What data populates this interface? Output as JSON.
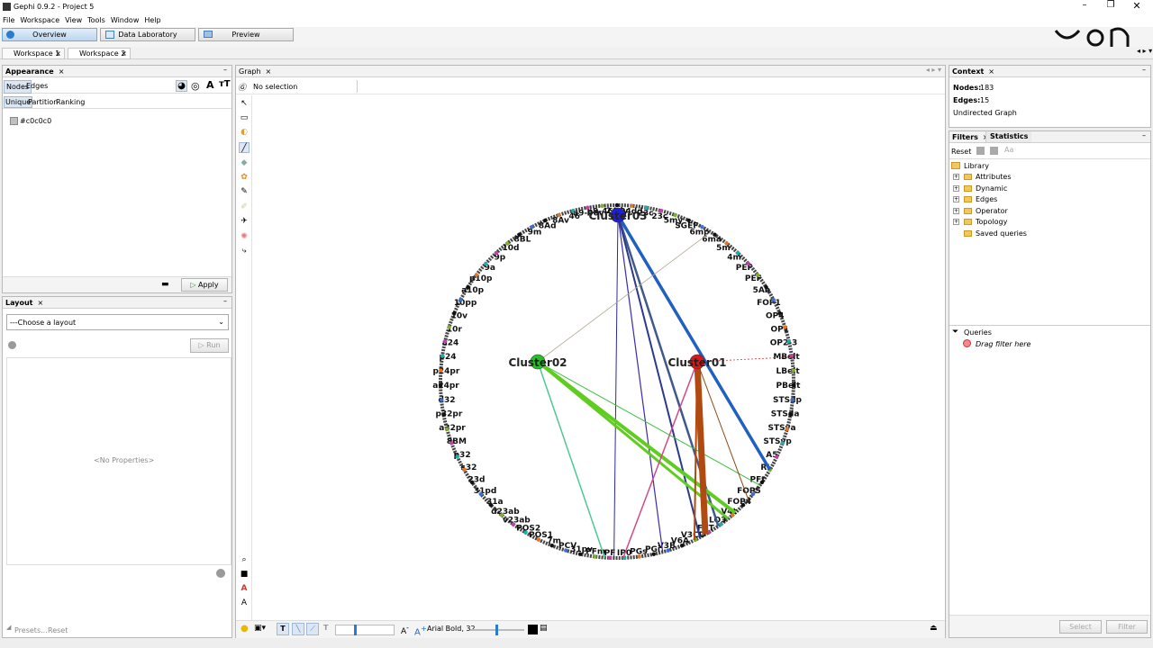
{
  "window": {
    "title": "Gephi 0.9.2 - Project 5"
  },
  "menu": [
    "File",
    "Workspace",
    "View",
    "Tools",
    "Window",
    "Help"
  ],
  "modes": {
    "overview": "Overview",
    "data_lab": "Data Laboratory",
    "preview": "Preview"
  },
  "workspaces": [
    "Workspace 1",
    "Workspace 2"
  ],
  "appearance": {
    "title": "Appearance",
    "tabs": [
      "Nodes",
      "Edges"
    ],
    "subtabs": [
      "Unique",
      "Partition",
      "Ranking"
    ],
    "color_value": "#c0c0c0",
    "apply": "Apply"
  },
  "layout": {
    "title": "Layout",
    "choose": "---Choose a layout",
    "run": "Run",
    "no_props": "<No Properties>",
    "presets": "Presets...",
    "reset": "Reset"
  },
  "graph": {
    "tab": "Graph",
    "selection": "No selection",
    "font_label": "Arial Bold, 32",
    "clusters": [
      {
        "label": "Cluster03",
        "color": "#1f1fd6"
      },
      {
        "label": "Cluster02",
        "color": "#22c422"
      },
      {
        "label": "Cluster01",
        "color": "#e41414"
      }
    ],
    "ring_labels": [
      "24dy",
      "24dd",
      "23c",
      "23c",
      "5my",
      "SGEF",
      "6mp",
      "6ma",
      "5m",
      "4m",
      "PEF",
      "PEF",
      "5Ab",
      "FOP1",
      "OP4",
      "OP1",
      "OP2-3",
      "MBelt",
      "LBelt",
      "PBelt",
      "STSdp",
      "STSda",
      "STSva",
      "STSvp",
      "A5",
      "RI",
      "PFt",
      "FOP5",
      "FOP4",
      "V4t",
      "LO3",
      "FST",
      "V3CD",
      "V6A",
      "V3B",
      "PGi",
      "PGs",
      "IP0",
      "PF",
      "PFm",
      "31pv",
      "PCV",
      "7m",
      "POS1",
      "POS2",
      "v23ab",
      "d23ab",
      "31a",
      "31pd",
      "23d",
      "s32",
      "p32",
      "8BM",
      "a32pr",
      "p32pr",
      "d32",
      "a24pr",
      "p24pr",
      "p24",
      "a24",
      "10r",
      "10v",
      "10pp",
      "a10p",
      "p10p",
      "9a",
      "9p",
      "10d",
      "8BL",
      "9m",
      "8Ad",
      "8Av",
      "46",
      "a9-46v",
      "p9-46v"
    ]
  },
  "context": {
    "title": "Context",
    "nodes_label": "Nodes:",
    "nodes": "183",
    "edges_label": "Edges:",
    "edges": "15",
    "type": "Undirected Graph"
  },
  "filters": {
    "title": "Filters",
    "stats_title": "Statistics",
    "reset": "Reset",
    "library": "Library",
    "items": [
      "Attributes",
      "Dynamic",
      "Edges",
      "Operator",
      "Topology",
      "Saved queries"
    ],
    "queries": "Queries",
    "drag": "Drag filter here",
    "select": "Select",
    "filter": "Filter"
  }
}
